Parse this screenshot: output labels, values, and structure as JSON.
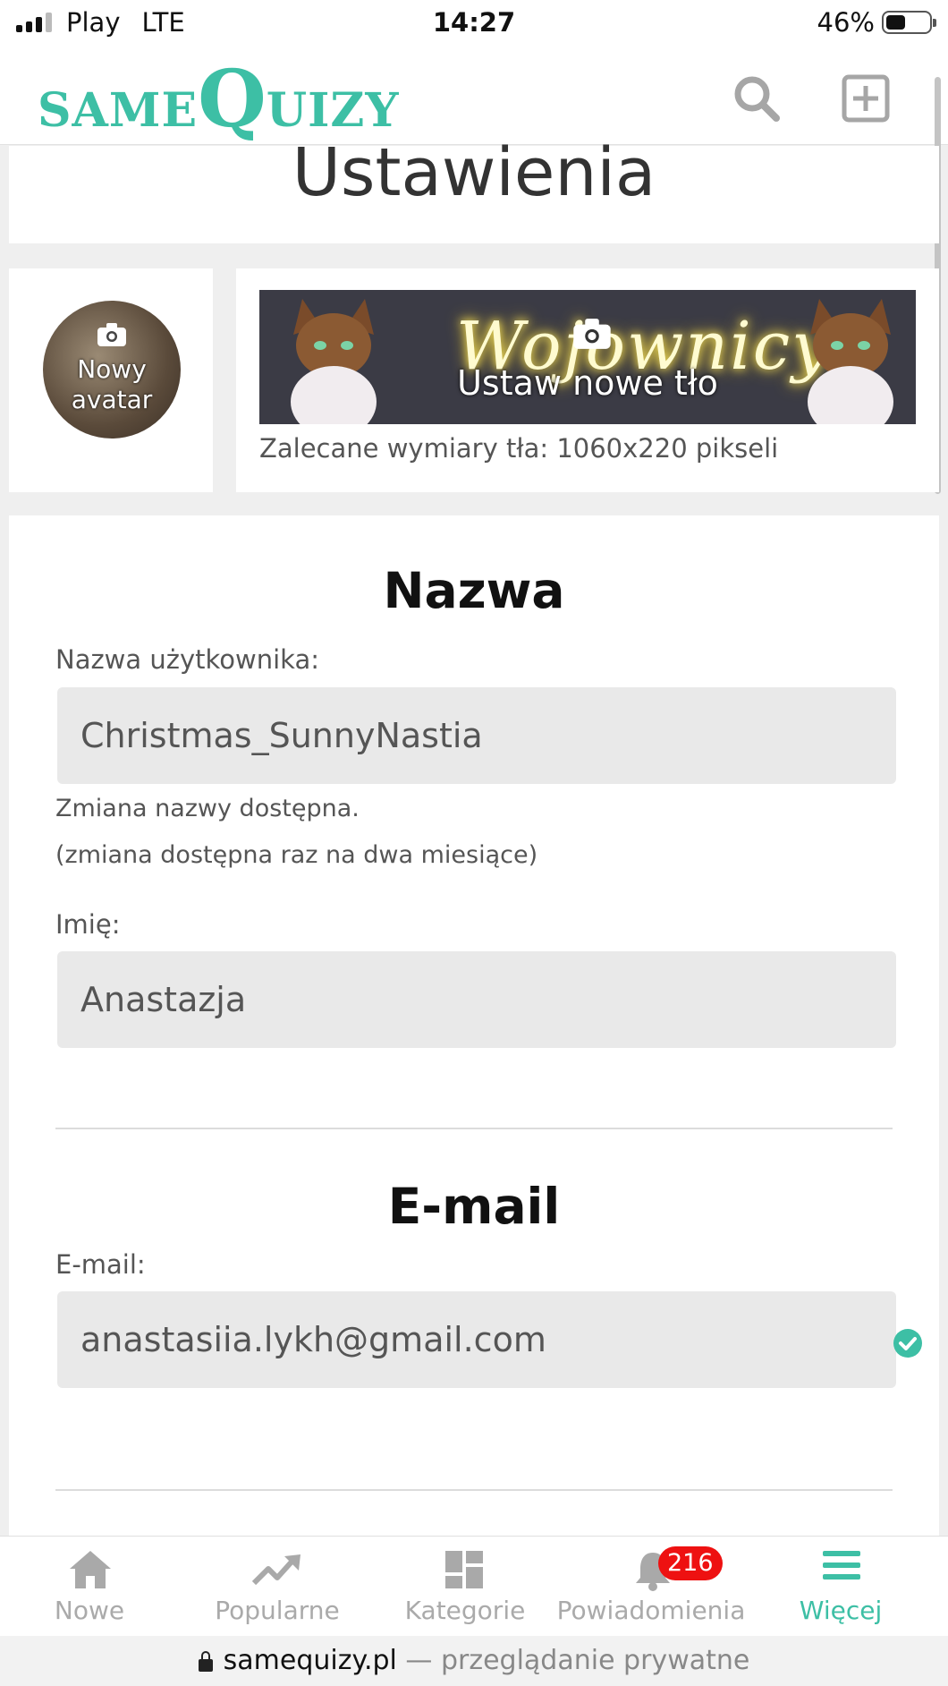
{
  "status_bar": {
    "carrier": "Play",
    "network": "LTE",
    "time": "14:27",
    "battery": "46%",
    "battery_level": 0.46
  },
  "header": {
    "logo": {
      "part1": "SAME",
      "part2": "Q",
      "part3": "UIZY"
    },
    "search_icon": "search-icon",
    "add_icon": "plus-square-icon"
  },
  "page": {
    "title": "Ustawienia"
  },
  "profile": {
    "avatar_label": "Nowy avatar",
    "background_label": "Ustaw nowe tło",
    "background_art_text": "Wojownicy",
    "background_hint": "Zalecane wymiary tła: 1060x220 pikseli"
  },
  "name_section": {
    "title": "Nazwa",
    "username_label": "Nazwa użytkownika:",
    "username_value": "Christmas_SunnyNastia",
    "note1": "Zmiana nazwy dostępna.",
    "note2": "(zmiana dostępna raz na dwa miesiące)",
    "first_name_label": "Imię:",
    "first_name_value": "Anastazja"
  },
  "email_section": {
    "title": "E-mail",
    "email_label": "E-mail:",
    "email_value": "anastasiia.lykh@gmail.com",
    "verified_icon": "check-circle-icon"
  },
  "bottom_nav": {
    "items": [
      {
        "label": "Nowe",
        "icon": "home-icon"
      },
      {
        "label": "Popularne",
        "icon": "trending-icon"
      },
      {
        "label": "Kategorie",
        "icon": "dashboard-icon"
      },
      {
        "label": "Powiadomienia",
        "icon": "bell-icon"
      },
      {
        "label": "Więcej",
        "icon": "menu-icon"
      }
    ],
    "notification_count": "216"
  },
  "browser": {
    "domain": "samequizy.pl",
    "mode": " — przeglądanie prywatne"
  },
  "colors": {
    "accent": "#3dbfa5",
    "badge": "#e11111"
  }
}
